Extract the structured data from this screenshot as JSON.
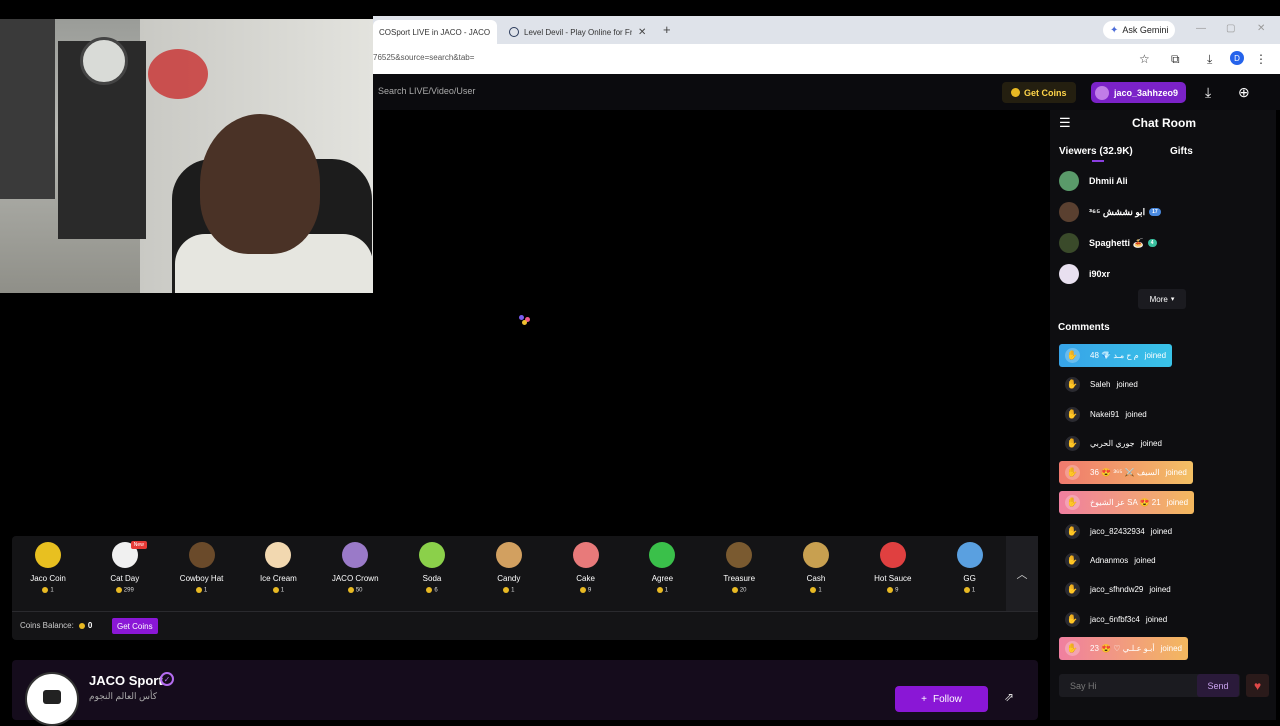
{
  "browser": {
    "tabs": [
      {
        "title": "COSport LIVE in JACO - JACO"
      },
      {
        "title": "Level Devil - Play Online for Fre"
      }
    ],
    "new_tab_label": "+",
    "gemini_label": "Ask Gemini",
    "url": "76525&source=search&tab=",
    "profile_initial": "D"
  },
  "header": {
    "search_placeholder": "Search LIVE/Video/User",
    "get_coins_label": "Get Coins",
    "username": "jaco_3ahhzeo9"
  },
  "gifts": [
    {
      "name": "Jaco Coin",
      "price": "1",
      "color": "#e8c020"
    },
    {
      "name": "Cat Day",
      "price": "299",
      "color": "#f0f0f0",
      "badge": "New"
    },
    {
      "name": "Cowboy Hat",
      "price": "1",
      "color": "#6a4a2a"
    },
    {
      "name": "Ice Cream",
      "price": "1",
      "color": "#f2d8b0"
    },
    {
      "name": "JACO Crown",
      "price": "50",
      "color": "#9a7ac8"
    },
    {
      "name": "Soda",
      "price": "6",
      "color": "#8bd04a"
    },
    {
      "name": "Candy",
      "price": "1",
      "color": "#d2a060"
    },
    {
      "name": "Cake",
      "price": "9",
      "color": "#e87a7a"
    },
    {
      "name": "Agree",
      "price": "1",
      "color": "#3ac04a"
    },
    {
      "name": "Treasure",
      "price": "20",
      "color": "#7a5a30"
    },
    {
      "name": "Cash",
      "price": "1",
      "color": "#c8a050"
    },
    {
      "name": "Hot Sauce",
      "price": "9",
      "color": "#e04040"
    },
    {
      "name": "GG",
      "price": "1",
      "color": "#5aa0e0"
    }
  ],
  "coins_balance": {
    "label": "Coins Balance:",
    "value": "0",
    "button": "Get Coins"
  },
  "streamer": {
    "name": "JACO Sport",
    "subtitle": "كأس العالم النجوم",
    "follow_label": "Follow"
  },
  "chat": {
    "title": "Chat Room",
    "tab_viewers": "Viewers (32.9K)",
    "tab_gifts": "Gifts",
    "viewers": [
      {
        "name": "Dhmii Ali",
        "avatar": "#5a9a6a"
      },
      {
        "name": "ابو نششش ³⁶⁵",
        "avatar": "#5a4030",
        "badge": "17",
        "badge_color": "#4a8ae0"
      },
      {
        "name": "Spaghetti 🍝",
        "avatar": "#3a4a2a",
        "badge": "4",
        "badge_color": "#3ac0a0"
      },
      {
        "name": "i90xr",
        "avatar": "#e8e0f0"
      }
    ],
    "more_label": "More",
    "comments_title": "Comments",
    "comments": [
      {
        "user": "م ح مـد 💎 48",
        "action": "joined",
        "style": "blue"
      },
      {
        "user": "Saleh",
        "action": "joined",
        "style": "plain"
      },
      {
        "user": "Nakei91",
        "action": "joined",
        "style": "plain"
      },
      {
        "user": "جوري الحربي",
        "action": "joined",
        "style": "plain"
      },
      {
        "user": "السيف ⚔️ ³⁶⁵ 😍 36",
        "action": "joined",
        "style": "orange"
      },
      {
        "user": "عز الشيوخ SA 😍 21",
        "action": "joined",
        "style": "pink"
      },
      {
        "user": "jaco_82432934",
        "action": "joined",
        "style": "plain"
      },
      {
        "user": "Adnanmos",
        "action": "joined",
        "style": "plain"
      },
      {
        "user": "jaco_sfhndw29",
        "action": "joined",
        "style": "plain"
      },
      {
        "user": "jaco_6nfbf3c4",
        "action": "joined",
        "style": "plain"
      },
      {
        "user": "أبـو عـلـي ♡ 😍 23",
        "action": "joined",
        "style": "pink"
      }
    ],
    "input_placeholder": "Say Hi",
    "send_label": "Send"
  }
}
